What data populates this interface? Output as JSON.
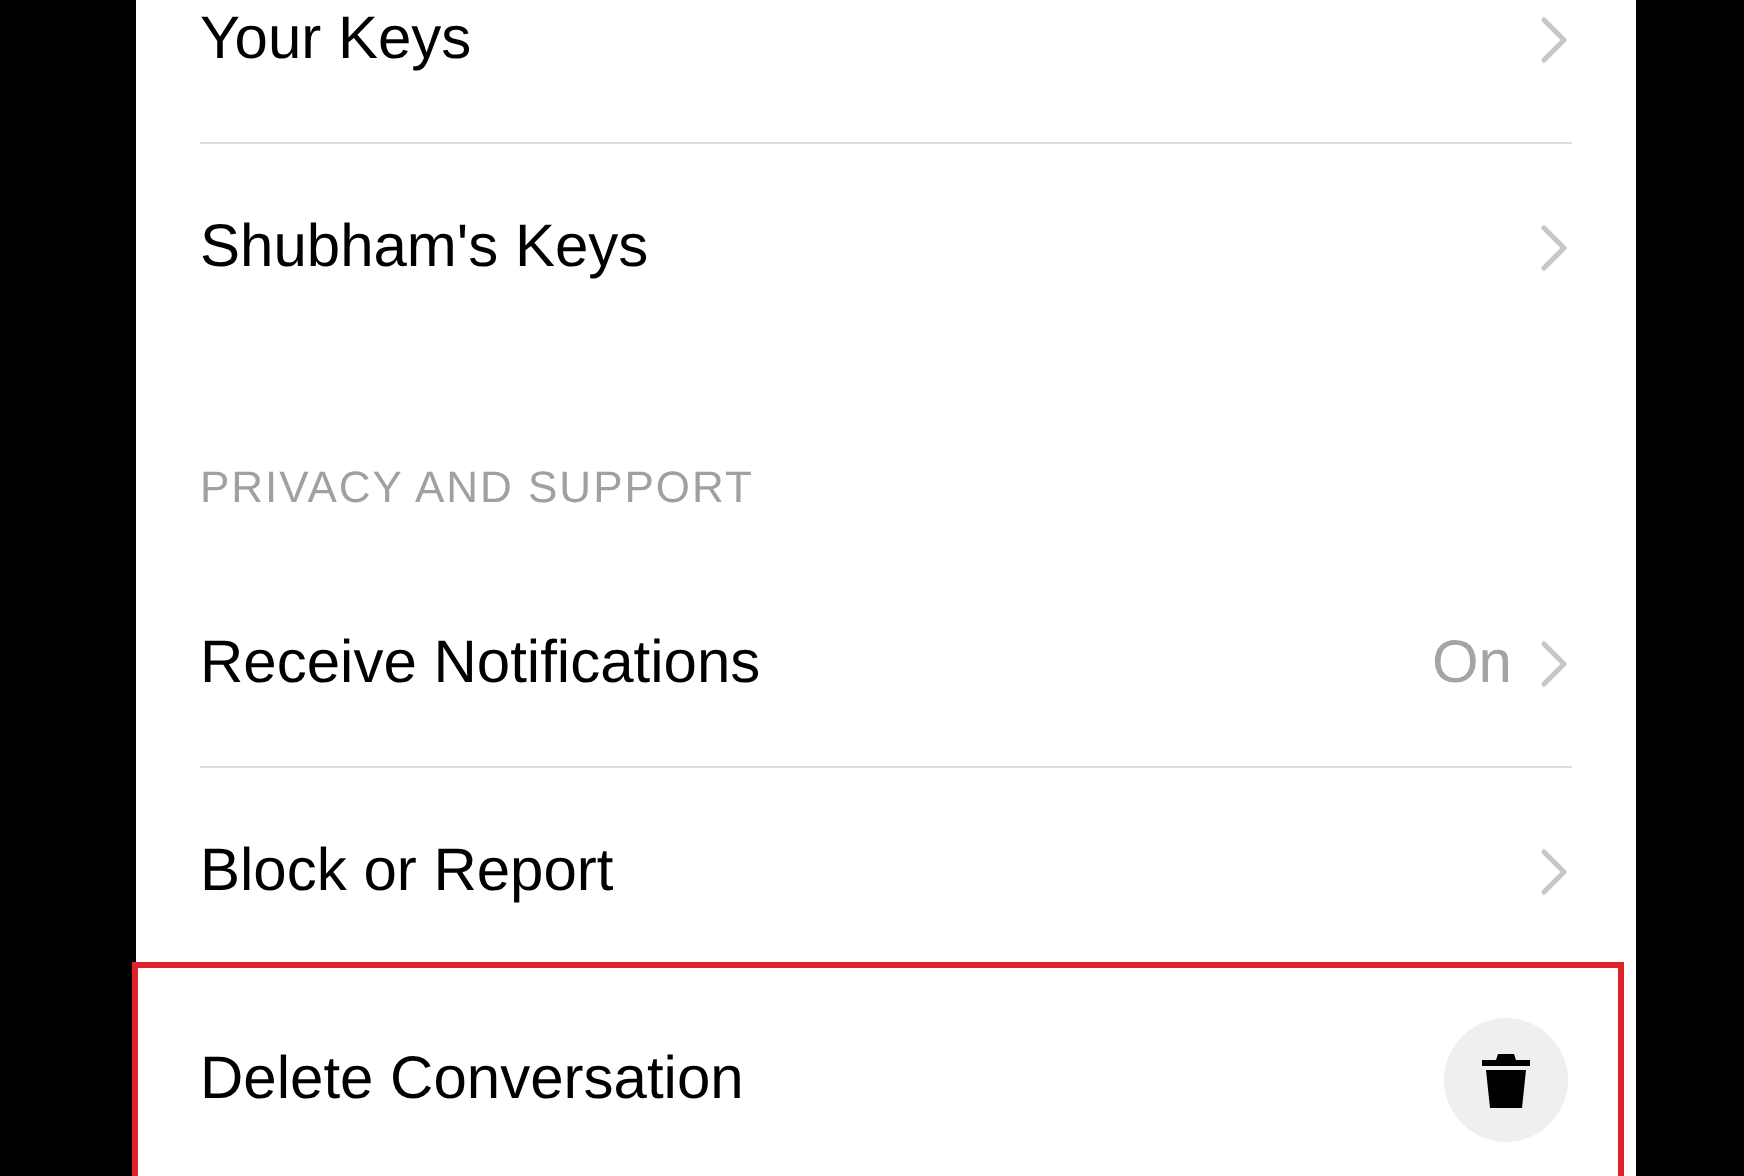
{
  "sections": [
    {
      "rows": [
        {
          "kind": "link",
          "label": "Your Keys"
        },
        {
          "kind": "link",
          "label": "Shubham's Keys"
        }
      ]
    },
    {
      "header": "PRIVACY AND SUPPORT",
      "rows": [
        {
          "kind": "link",
          "label": "Receive Notifications",
          "value": "On"
        },
        {
          "kind": "link",
          "label": "Block or Report"
        },
        {
          "kind": "action",
          "label": "Delete Conversation",
          "highlighted": true
        }
      ]
    }
  ]
}
